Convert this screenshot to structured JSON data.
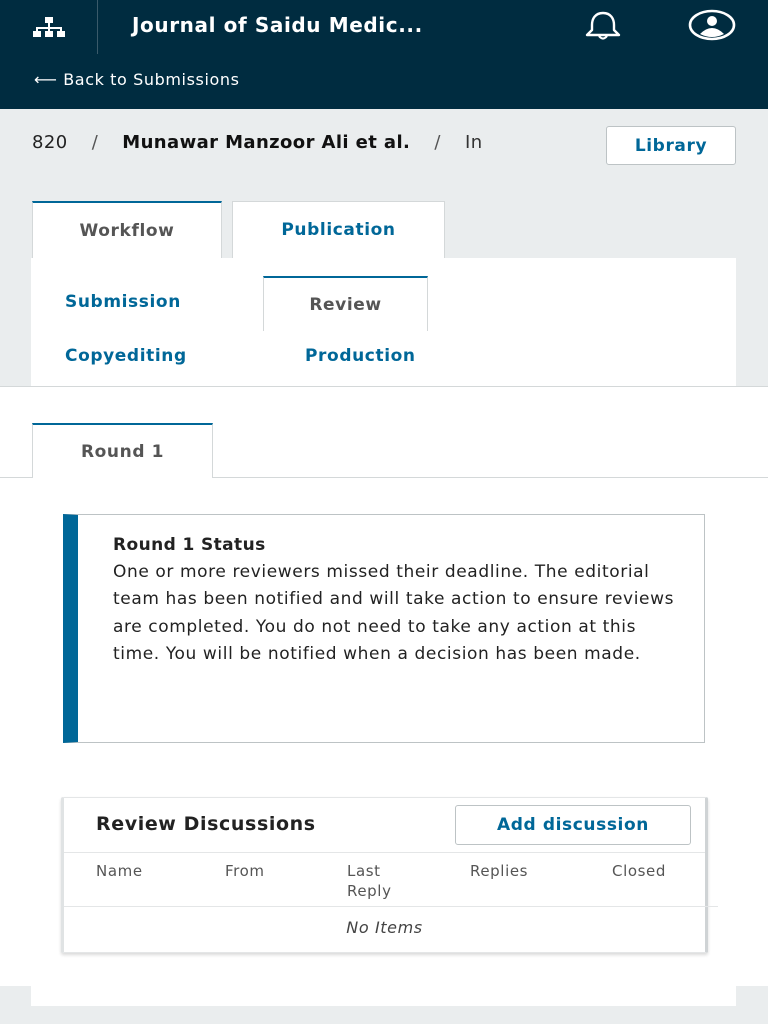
{
  "header": {
    "journal_title": "Journal of Saidu Medic...",
    "back_link": "⟵ Back to Submissions",
    "icons": [
      "sitemap-icon",
      "bell-icon",
      "user-avatar-icon"
    ]
  },
  "breadcrumb": {
    "submission_id": "820",
    "separator": "/",
    "authors": "Munawar Manzoor Ali et al.",
    "title_fragment": "In",
    "library_button": "Library"
  },
  "tabs": {
    "workflow": "Workflow",
    "publication": "Publication",
    "active": "Workflow"
  },
  "stages": {
    "submission": "Submission",
    "review": "Review",
    "copyediting": "Copyediting",
    "production": "Production",
    "active": "Review"
  },
  "round": {
    "tab_label": "Round 1",
    "status_title": "Round 1 Status",
    "status_text": "One or more reviewers missed their deadline. The editorial team has been notified and will take action to ensure reviews are completed. You do not need to take any action at this time. You will be notified when a decision has been made."
  },
  "discussions": {
    "title": "Review Discussions",
    "add_button": "Add discussion",
    "columns": {
      "name": "Name",
      "from": "From",
      "last_reply_line1": "Last",
      "last_reply_line2": "Reply",
      "replies": "Replies",
      "closed": "Closed"
    },
    "empty_text": "No Items"
  },
  "colors": {
    "header_bg": "#002c40",
    "accent": "#006798",
    "page_bg": "#eaedee"
  }
}
